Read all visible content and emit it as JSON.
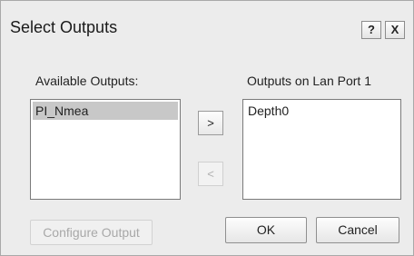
{
  "dialog": {
    "title": "Select Outputs",
    "help_label": "?",
    "close_label": "X"
  },
  "available": {
    "label": "Available Outputs:",
    "items": [
      "PI_Nmea"
    ],
    "selected_index": 0
  },
  "port": {
    "label": "Outputs on Lan Port 1",
    "items": [
      "Depth0"
    ]
  },
  "buttons": {
    "move_right": ">",
    "move_left": "<",
    "configure": "Configure Output",
    "ok": "OK",
    "cancel": "Cancel"
  }
}
